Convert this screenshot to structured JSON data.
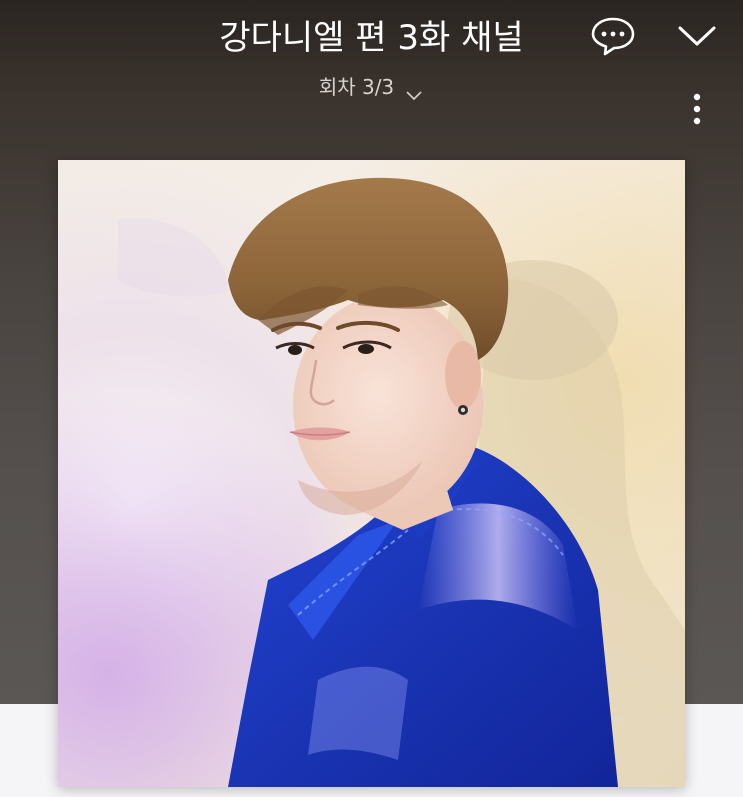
{
  "header": {
    "title": "강다니엘 편 3화 채널",
    "episode_label": "회차 3/3"
  },
  "icons": {
    "chat": "chat-bubble-icon",
    "collapse": "chevron-down-icon",
    "episode_dropdown": "chevron-down-icon",
    "more": "more-vertical-icon"
  },
  "album": {
    "description_icon": "album-art-image"
  },
  "colors": {
    "header_bg": "#2b2521",
    "text_primary": "#ffffff",
    "jacket_blue": "#1f3fbf"
  }
}
